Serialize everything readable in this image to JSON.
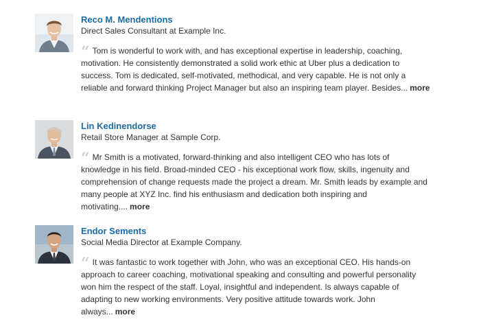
{
  "recommendations": [
    {
      "name": "Reco M. Mendentions",
      "title": "Direct Sales Consultant at Example Inc.",
      "quote_icon": "quote-mark-icon",
      "text": "Tom is wonderful to work with, and has exceptional expertise in leadership, coaching, motivation. He consistently demonstrated a solid work ethic at Uber plus a dedication to success. Tom is dedicated, self-motivated, methodical, and very capable. He is not only a reliable and forward thinking Project Manager but also an inspiring team player. Besides...",
      "more_label": "more"
    },
    {
      "name": "Lin Kedinendorse",
      "title": "Retail Store Manager at Sample Corp.",
      "quote_icon": "quote-mark-icon",
      "text": "Mr Smith is a motivated, forward-thinking and also intelligent CEO who has lots of knowledge in his field. Broad-minded CEO - his exceptional work flow, skills, ingenuity and comprehension of change requests made the project a dream. Mr. Smith leads by example and many people at XYZ Inc. find his enthusiasm and dedication both inspiring and motivating....",
      "more_label": "more"
    },
    {
      "name": "Endor Sements",
      "title": "Social Media Director at Example Company.",
      "quote_icon": "quote-mark-icon",
      "text": "It was fantastic to work together with John, who was an exceptional CEO. His hands-on approach to career coaching, motivational speaking and consulting and powerful personality won him the respect of the staff. Loyal, insightful and independent. Is always capable of adapting to new working environments. Very positive attitude towards work. John always...",
      "more_label": "more"
    }
  ],
  "colors": {
    "name_link": "#1a6aa6",
    "body_text": "#333333",
    "quote_mark": "#cfcfcf"
  }
}
